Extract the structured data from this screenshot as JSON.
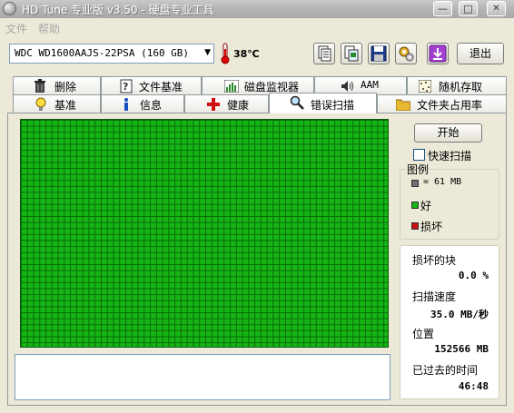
{
  "window": {
    "title": "HD Tune 专业版 v3.50 - 硬盘专业工具",
    "minimize": "—",
    "maximize": "□",
    "close": "✕"
  },
  "menu": {
    "items": [
      {
        "label": "文件"
      },
      {
        "label": "帮助"
      }
    ]
  },
  "toolbar": {
    "drive": "WDC WD1600AAJS-22PSA (160 GB)",
    "temperature": "38℃",
    "exit_label": "退出",
    "buttons": [
      {
        "icon": "copy-text-icon"
      },
      {
        "icon": "copy-screen-icon"
      },
      {
        "icon": "save-icon"
      },
      {
        "icon": "options-icon"
      },
      {
        "icon": "download-icon"
      }
    ]
  },
  "tabs": {
    "row1": [
      {
        "label": "删除",
        "icon": "trash-icon"
      },
      {
        "label": "文件基准",
        "icon": "file-benchmark-icon"
      },
      {
        "label": "磁盘监视器",
        "icon": "disk-monitor-icon"
      },
      {
        "label": "AAM",
        "icon": "speaker-icon"
      },
      {
        "label": "随机存取",
        "icon": "random-access-icon"
      }
    ],
    "row2": [
      {
        "label": "基准",
        "icon": "bulb-icon"
      },
      {
        "label": "信息",
        "icon": "info-icon"
      },
      {
        "label": "健康",
        "icon": "health-cross-icon"
      },
      {
        "label": "错误扫描",
        "icon": "magnifier-icon",
        "active": true
      },
      {
        "label": "文件夹占用率",
        "icon": "folder-icon"
      }
    ]
  },
  "scan": {
    "start_label": "开始",
    "quick_scan_label": "快速扫描",
    "quick_scan_checked": false,
    "legend_title": "图例",
    "legend": [
      {
        "label": "= 61 MB",
        "color": "#707070"
      },
      {
        "label": "好",
        "color": "#14b514"
      },
      {
        "label": "损坏",
        "color": "#cc1010"
      }
    ],
    "block_status": "all-good",
    "stats": {
      "damaged_label": "损坏的块",
      "damaged_value": "0.0 %",
      "speed_label": "扫描速度",
      "speed_value": "35.0 MB/秒",
      "position_label": "位置",
      "position_value": "152566 MB",
      "elapsed_label": "已过去的时间",
      "elapsed_value": "46:48"
    }
  }
}
